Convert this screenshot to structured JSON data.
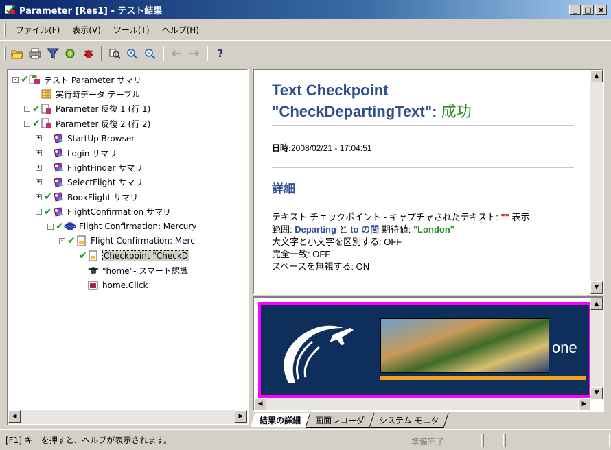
{
  "window": {
    "title": "Parameter [Res1] - テスト結果",
    "controls": [
      "_",
      "□",
      "×"
    ]
  },
  "menu": [
    {
      "label": "ファイル(F)"
    },
    {
      "label": "表示(V)"
    },
    {
      "label": "ツール(T)"
    },
    {
      "label": "ヘルプ(H)"
    }
  ],
  "toolbar": {
    "icons": [
      "open-folder-icon",
      "print-icon",
      "filter-icon",
      "find-icon",
      "bug-icon",
      "zoom-in-icon",
      "zoom-tree-icon",
      "zoom-node-icon",
      "back-arrow-icon",
      "forward-arrow-icon",
      "help-icon"
    ],
    "help_label": "?"
  },
  "tree": {
    "nodes": [
      {
        "label": "テスト Parameter サマリ",
        "level": 0,
        "icon": "test-icon",
        "checked": true,
        "expander": "-"
      },
      {
        "label": "実行時データ テーブル",
        "level": 1,
        "icon": "table-icon",
        "checked": false,
        "expander": ""
      },
      {
        "label": "Parameter 反復 1 (行 1)",
        "level": 1,
        "icon": "iteration-icon",
        "checked": true,
        "expander": "+"
      },
      {
        "label": "Parameter 反復 2 (行 2)",
        "level": 1,
        "icon": "iteration-icon",
        "checked": true,
        "expander": "-"
      },
      {
        "label": "StartUp Browser",
        "level": 2,
        "icon": "action-icon",
        "checked": false,
        "expander": "+"
      },
      {
        "label": "Login サマリ",
        "level": 2,
        "icon": "action-icon",
        "checked": false,
        "expander": "+"
      },
      {
        "label": "FlightFinder サマリ",
        "level": 2,
        "icon": "action-icon",
        "checked": false,
        "expander": "+"
      },
      {
        "label": "SelectFlight サマリ",
        "level": 2,
        "icon": "action-icon",
        "checked": false,
        "expander": "+"
      },
      {
        "label": "BookFlight サマリ",
        "level": 2,
        "icon": "action-icon",
        "checked": true,
        "expander": "+"
      },
      {
        "label": "FlightConfirmation サマリ",
        "level": 2,
        "icon": "action-icon",
        "checked": true,
        "expander": "-"
      },
      {
        "label": "Flight Confirmation: Mercury",
        "level": 3,
        "icon": "browser-icon",
        "checked": true,
        "expander": "-"
      },
      {
        "label": "Flight Confirmation: Merc",
        "level": 4,
        "icon": "page-icon",
        "checked": true,
        "expander": "-"
      },
      {
        "label": "Checkpoint \"CheckD",
        "level": 5,
        "icon": "checkpoint-icon",
        "checked": true,
        "expander": "",
        "selected": true
      },
      {
        "label": "\"home\"- スマート認識",
        "level": 5,
        "icon": "smart-icon",
        "checked": false,
        "expander": ""
      },
      {
        "label": "home.Click",
        "level": 5,
        "icon": "click-icon",
        "checked": false,
        "expander": ""
      }
    ]
  },
  "detail": {
    "title_line1": "Text Checkpoint",
    "title_line2": "\"CheckDepartingText\":",
    "status": "成功",
    "datetime_label": "日時:",
    "datetime_value": "2008/02/21 - 17:04:51",
    "section": "詳細",
    "line1_prefix": "テキスト チェックポイント - キャプチャされたテキスト:",
    "line1_value": "\"\"",
    "line1_suffix": "表示",
    "line2_prefix": "範囲:",
    "line2_from": "Departing",
    "line2_mid": "と",
    "line2_to": "to の間",
    "line2_expected_label": "期待値:",
    "line2_expected": "\"London\"",
    "line3": "大文字と小文字を区別する: OFF",
    "line4": "完全一致: OFF",
    "line5": "スペースを無視する: ON"
  },
  "capture": {
    "banner_text": "one"
  },
  "tabs": [
    {
      "label": "結果の詳細",
      "active": true
    },
    {
      "label": "画面レコーダ",
      "active": false
    },
    {
      "label": "システム モニタ",
      "active": false
    }
  ],
  "status": {
    "message": "[F1] キーを押すと、ヘルプが表示されます。",
    "ready": "準備完了"
  },
  "colors": {
    "accent_blue": "#2f4f8f",
    "success_green": "#2a8c2a",
    "capture_border": "#ff00ff"
  }
}
